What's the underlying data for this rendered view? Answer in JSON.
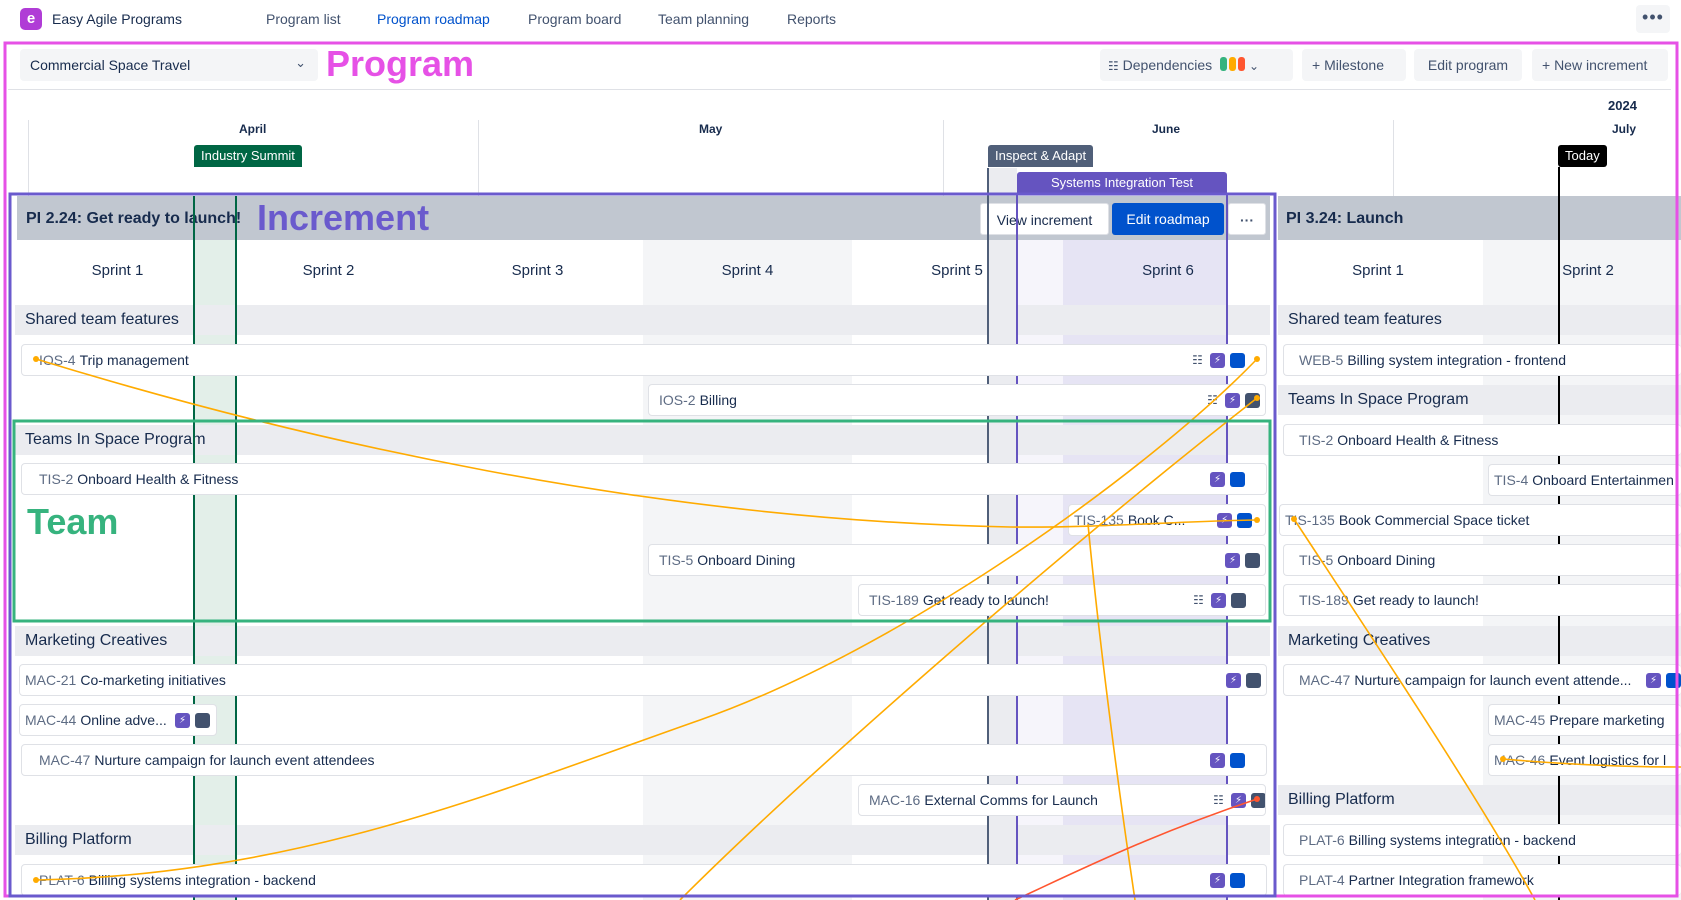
{
  "app": {
    "logo_letter": "e",
    "title": "Easy Agile Programs"
  },
  "nav": {
    "items": [
      {
        "label": "Program list"
      },
      {
        "label": "Program roadmap",
        "active": true
      },
      {
        "label": "Program board"
      },
      {
        "label": "Team planning"
      },
      {
        "label": "Reports"
      }
    ],
    "more": "•••"
  },
  "toolbar": {
    "program_select": "Commercial Space Travel",
    "dependencies": "Dependencies",
    "milestone": "+ Milestone",
    "edit_program": "Edit program",
    "new_increment": "+ New increment"
  },
  "overlay_labels": {
    "program": "Program",
    "increment": "Increment",
    "team": "Team"
  },
  "timeline": {
    "year": "2024",
    "months": [
      "April",
      "May",
      "June",
      "July"
    ],
    "milestones": [
      "Industry Summit",
      "Inspect & Adapt",
      "Systems Integration Test"
    ],
    "today": "Today"
  },
  "increment1": {
    "title": "PI 2.24: Get ready to launch!",
    "view_btn": "View increment",
    "edit_btn": "Edit roadmap",
    "more_btn": "···",
    "sprints": [
      "Sprint 1",
      "Sprint 2",
      "Sprint 3",
      "Sprint 4",
      "Sprint 5",
      "Sprint 6"
    ],
    "teams": [
      "Shared team features",
      "Teams In Space Program",
      "Marketing Creatives",
      "Billing Platform"
    ],
    "cards": [
      {
        "key": "IOS-4",
        "summary": "Trip management"
      },
      {
        "key": "IOS-2",
        "summary": "Billing"
      },
      {
        "key": "TIS-2",
        "summary": "Onboard Health & Fitness"
      },
      {
        "key": "TIS-135",
        "summary": "Book C..."
      },
      {
        "key": "TIS-5",
        "summary": "Onboard Dining"
      },
      {
        "key": "TIS-189",
        "summary": "Get ready to launch!"
      },
      {
        "key": "MAC-21",
        "summary": "Co-marketing initiatives"
      },
      {
        "key": "MAC-44",
        "summary": "Online adve..."
      },
      {
        "key": "MAC-47",
        "summary": "Nurture campaign for launch event attendees"
      },
      {
        "key": "MAC-16",
        "summary": "External Comms for Launch"
      },
      {
        "key": "PLAT-6",
        "summary": "Billing systems integration - backend"
      }
    ]
  },
  "increment2": {
    "title": "PI 3.24: Launch",
    "sprints": [
      "Sprint 1",
      "Sprint 2"
    ],
    "teams": [
      "Shared team features",
      "Teams In Space Program",
      "Marketing Creatives",
      "Billing Platform"
    ],
    "cards": [
      {
        "key": "WEB-5",
        "summary": "Billing system integration - frontend"
      },
      {
        "key": "TIS-2",
        "summary": "Onboard Health & Fitness"
      },
      {
        "key": "TIS-4",
        "summary": "Onboard Entertainmen"
      },
      {
        "key": "TIS-135",
        "summary": "Book Commercial Space ticket"
      },
      {
        "key": "TIS-5",
        "summary": "Onboard Dining"
      },
      {
        "key": "TIS-189",
        "summary": "Get ready to launch!"
      },
      {
        "key": "MAC-47",
        "summary": "Nurture campaign for launch event attende..."
      },
      {
        "key": "MAC-45",
        "summary": "Prepare marketing"
      },
      {
        "key": "MAC-46",
        "summary": "Event logistics for l"
      },
      {
        "key": "PLAT-6",
        "summary": "Billing systems integration - backend"
      },
      {
        "key": "PLAT-4",
        "summary": "Partner Integration framework"
      }
    ]
  },
  "colors": {
    "program_frame": "#e651e6",
    "increment_frame": "#6a5acd",
    "team_frame": "#36b37e",
    "dependency_line": "#ffab00",
    "dependency_conflict": "#ff5630",
    "primary": "#0052cc"
  }
}
